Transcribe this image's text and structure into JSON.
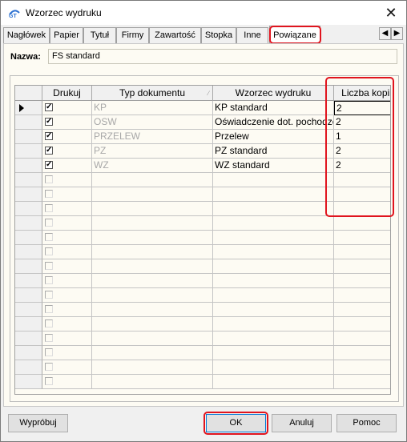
{
  "window": {
    "title": "Wzorzec wydruku",
    "close_glyph": "✕"
  },
  "tabs": [
    {
      "label": "Nagłówek"
    },
    {
      "label": "Papier"
    },
    {
      "label": "Tytuł"
    },
    {
      "label": "Firmy"
    },
    {
      "label": "Zawartość"
    },
    {
      "label": "Stopka"
    },
    {
      "label": "Inne"
    },
    {
      "label": "Powiązane",
      "active": true
    }
  ],
  "tab_scroll": {
    "left": "◀",
    "right": "▶"
  },
  "name": {
    "label": "Nazwa:",
    "value": "FS standard"
  },
  "grid": {
    "columns": [
      "Drukuj",
      "Typ dokumentu",
      "Wzorzec wydruku",
      "Liczba kopii"
    ],
    "sort_glyph": "∕",
    "rows": [
      {
        "checked": true,
        "type": "KP",
        "template": "KP standard",
        "copies": "2"
      },
      {
        "checked": true,
        "type": "OSW",
        "template": "Oświadczenie dot. pochodzenia",
        "copies": "2"
      },
      {
        "checked": true,
        "type": "PRZELEW",
        "template": "Przelew",
        "copies": "1"
      },
      {
        "checked": true,
        "type": "PZ",
        "template": "PZ standard",
        "copies": "2"
      },
      {
        "checked": true,
        "type": "WZ",
        "template": "WZ standard",
        "copies": "2"
      }
    ],
    "empty_rows": 15
  },
  "buttons": {
    "try": "Wypróbuj",
    "ok": "OK",
    "cancel": "Anuluj",
    "help": "Pomoc"
  },
  "colors": {
    "highlight": "#e0141e",
    "panel_bg": "#fdfbf3",
    "focus_border": "#0078d7"
  }
}
